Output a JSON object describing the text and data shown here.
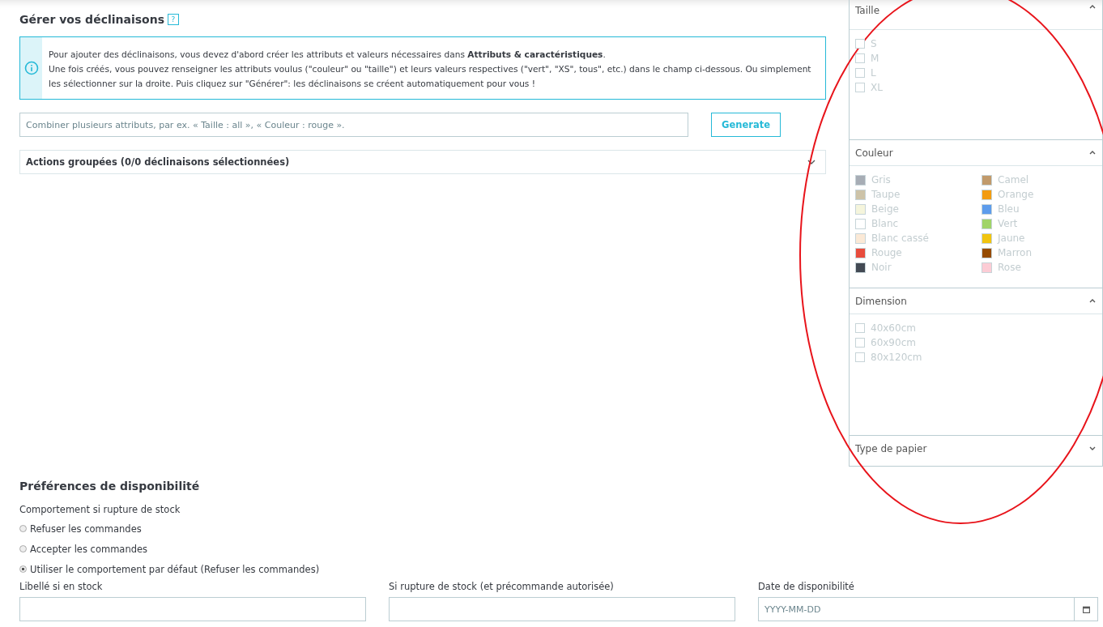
{
  "heading": {
    "title": "Gérer vos déclinaisons",
    "help": "?"
  },
  "info": {
    "text": "Pour ajouter des déclinaisons, vous devez d'abord créer les attributs et valeurs nécessaires dans **Attributs & caractéristiques**.\nUne fois créés, vous pouvez renseigner les attributs voulus (\"couleur\" ou \"taille\") et leurs valeurs respectives (\"vert\", \"XS\", tous\", etc.) dans le champ ci-dessous. Ou simplement les sélectionner sur la droite. Puis cliquez sur \"Générer\": les déclinaisons se créent automatiquement pour vous !"
  },
  "combine": {
    "placeholder": "Combiner plusieurs attributs, par ex. « Taille : all », « Couleur : rouge ».",
    "button": "Generate"
  },
  "bulk_actions": {
    "label": "Actions groupées (0/0 déclinaisons sélectionnées)",
    "expanded": false
  },
  "attribute_panels": [
    {
      "title": "Taille",
      "kind": "checkbox",
      "expanded": true,
      "values": [
        {
          "label": "S",
          "checked": false
        },
        {
          "label": "M",
          "checked": false
        },
        {
          "label": "L",
          "checked": false
        },
        {
          "label": "XL",
          "checked": false
        }
      ]
    },
    {
      "title": "Couleur",
      "kind": "color",
      "expanded": true,
      "values": [
        {
          "label": "Gris",
          "color": "#a7adb5"
        },
        {
          "label": "Taupe",
          "color": "#cdc3a8"
        },
        {
          "label": "Beige",
          "color": "#f5f5dc"
        },
        {
          "label": "Blanc",
          "color": "#ffffff"
        },
        {
          "label": "Blanc cassé",
          "color": "#fbe9d6"
        },
        {
          "label": "Rouge",
          "color": "#e84c3d"
        },
        {
          "label": "Noir",
          "color": "#434a54"
        },
        {
          "label": "Camel",
          "color": "#c19a6b"
        },
        {
          "label": "Orange",
          "color": "#f39c11"
        },
        {
          "label": "Bleu",
          "color": "#5d9cec"
        },
        {
          "label": "Vert",
          "color": "#a0d468"
        },
        {
          "label": "Jaune",
          "color": "#f1c40f"
        },
        {
          "label": "Marron",
          "color": "#964b00"
        },
        {
          "label": "Rose",
          "color": "#fcccd5"
        }
      ]
    },
    {
      "title": "Dimension",
      "kind": "checkbox",
      "expanded": true,
      "values": [
        {
          "label": "40x60cm",
          "checked": false
        },
        {
          "label": "60x90cm",
          "checked": false
        },
        {
          "label": "80x120cm",
          "checked": false
        }
      ]
    },
    {
      "title": "Type de papier",
      "expanded": false
    }
  ],
  "availability": {
    "title": "Préférences de disponibilité",
    "behaviour_label": "Comportement si rupture de stock",
    "options": [
      {
        "label": "Refuser les commandes",
        "selected": false
      },
      {
        "label": "Accepter les commandes",
        "selected": false
      },
      {
        "label": "Utiliser le comportement par défaut (Refuser les commandes)",
        "selected": true
      }
    ],
    "fields": [
      {
        "label": "Libellé si en stock",
        "kind": "text"
      },
      {
        "label": "Si rupture de stock (et précommande autorisée)",
        "kind": "text"
      },
      {
        "label": "Date de disponibilité",
        "kind": "date",
        "placeholder": "YYYY-MM-DD"
      }
    ]
  }
}
